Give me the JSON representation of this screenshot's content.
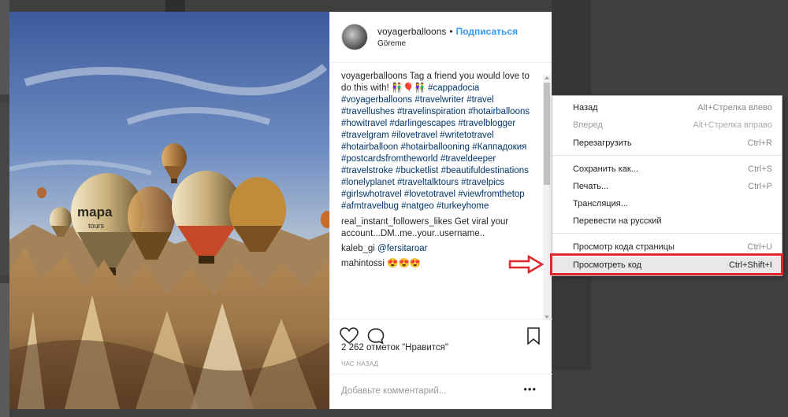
{
  "post": {
    "username": "voyagerballoons",
    "separator": "•",
    "follow_label": "Подписаться",
    "location": "Göreme",
    "caption_author": "voyagerballoons",
    "caption_text": "Tag a friend you would love to do this with! 👫🎈👫",
    "hashtags": [
      "#cappadocia",
      "#voyagerballoons",
      "#travelwriter",
      "#travel",
      "#travellushes",
      "#travelinspiration",
      "#hotairballoons",
      "#howitravel",
      "#darlingescapes",
      "#travelblogger",
      "#travelgram",
      "#ilovetravel",
      "#writetotravel",
      "#hotairballoon",
      "#hotairballooning",
      "#Каппадокия",
      "#postcardsfromtheworld",
      "#traveldeeper",
      "#travelstroke",
      "#bucketlist",
      "#beautifuldestinations",
      "#lonelyplanet",
      "#traveltalktours",
      "#travelpics",
      "#girlswhotravel",
      "#lovetotravel",
      "#viewfromthetop",
      "#afmtravelbug",
      "#natgeo",
      "#turkeyhome"
    ],
    "comments": [
      {
        "author": "real_instant_followers_likes",
        "text": "Get viral your account...DM..me..your..username.."
      },
      {
        "author": "kaleb_gi",
        "mention": "@fersitaroar"
      },
      {
        "author": "mahintossi",
        "text": "😍😍😍"
      }
    ],
    "photo_sign_text": "mapa",
    "photo_sign_sub": "tours",
    "likes_text": "2 262 отметок \"Нравится\"",
    "time_text": "ЧАС НАЗАД",
    "add_comment_placeholder": "Добавьте комментарий...",
    "more_label": "•••"
  },
  "context_menu": {
    "items": [
      {
        "label": "Назад",
        "shortcut": "Alt+Стрелка влево",
        "disabled": false
      },
      {
        "label": "Вперед",
        "shortcut": "Alt+Стрелка вправо",
        "disabled": true
      },
      {
        "label": "Перезагрузить",
        "shortcut": "Ctrl+R",
        "disabled": false
      },
      {
        "label": "Сохранить как...",
        "shortcut": "Ctrl+S",
        "disabled": false
      },
      {
        "label": "Печать...",
        "shortcut": "Ctrl+P",
        "disabled": false
      },
      {
        "label": "Трансляция...",
        "shortcut": "",
        "disabled": false
      },
      {
        "label": "Перевести на русский",
        "shortcut": "",
        "disabled": false
      },
      {
        "label": "Просмотр кода страницы",
        "shortcut": "Ctrl+U",
        "disabled": false
      },
      {
        "label": "Просмотреть код",
        "shortcut": "Ctrl+Shift+I",
        "disabled": false,
        "highlighted": true
      }
    ]
  },
  "colors": {
    "accent": "#3897f0",
    "hashtag": "#003569",
    "highlight_border": "#e0252b",
    "arrow": "#e0252b"
  },
  "icons": [
    "heart-icon",
    "comment-icon",
    "bookmark-icon",
    "more-icon",
    "red-arrow-icon"
  ]
}
